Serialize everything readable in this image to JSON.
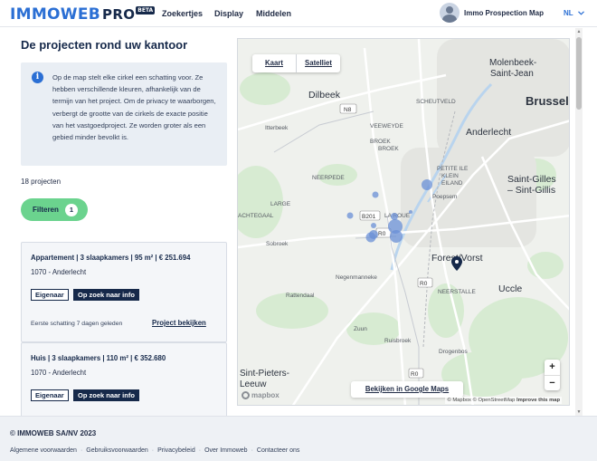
{
  "header": {
    "logo_text": "IMMOWEB",
    "logo_pro": "PRO",
    "logo_badge": "BETA",
    "nav": [
      "Zoekertjes",
      "Display",
      "Middelen"
    ],
    "user_name": "Immo Prospection Map",
    "language": "NL"
  },
  "main": {
    "title": "De projecten rond uw kantoor",
    "info_text": "Op de map stelt elke cirkel een schatting voor. Ze hebben verschillende kleuren, afhankelijk van de termijn van het project. Om de privacy te waarborgen, verbergt de grootte van de cirkels de exacte positie van het vastgoedproject. Ze worden groter als een gebied minder bevolkt is.",
    "project_count": "18 projecten",
    "filter_label": "Filteren",
    "filter_count": "1",
    "projects": [
      {
        "title": "Appartement | 3 slaapkamers | 95 m² | € 251.694",
        "location": "1070 - Anderlecht",
        "tag_owner": "Eigenaar",
        "tag_status": "Op zoek naar info",
        "date": "Eerste schatting 7 dagen geleden",
        "link": "Project bekijken"
      },
      {
        "title": "Huis | 3 slaapkamers | 110 m² | € 352.680",
        "location": "1070 - Anderlecht",
        "tag_owner": "Eigenaar",
        "tag_status": "Op zoek naar info"
      }
    ]
  },
  "map": {
    "view_map": "Kaart",
    "view_satellite": "Satelliet",
    "zoom_in": "+",
    "zoom_out": "−",
    "google_maps_button": "Bekijken in Google Maps",
    "mapbox_logo": "mapbox",
    "attribution": "© Mapbox © OpenStreetMap",
    "improve": "Improve this map",
    "labels": [
      {
        "text": "Molenbeek-",
        "cls": "big"
      },
      {
        "text": "Saint-Jean",
        "cls": "big"
      },
      {
        "text": "Brussels",
        "cls": "city"
      },
      {
        "text": "Dilbeek",
        "cls": "big"
      },
      {
        "text": "Anderlecht",
        "cls": "big"
      },
      {
        "text": "Saint-Gilles",
        "cls": "big"
      },
      {
        "text": "– Sint-Gillis",
        "cls": "big"
      },
      {
        "text": "Forest/Vorst",
        "cls": "big"
      },
      {
        "text": "Uccle",
        "cls": "big"
      },
      {
        "text": "Sint-Pieters-",
        "cls": "big"
      },
      {
        "text": "Leeuw",
        "cls": "big"
      },
      {
        "text": "Itterbeek",
        "cls": "small"
      },
      {
        "text": "SCHEUTVELD",
        "cls": "tiny"
      },
      {
        "text": "VEEWEYDE",
        "cls": "tiny"
      },
      {
        "text": "BROEK",
        "cls": "tiny"
      },
      {
        "text": "BROEK",
        "cls": "tiny"
      },
      {
        "text": "PETITE ILE",
        "cls": "tiny"
      },
      {
        "text": "KLEIN",
        "cls": "tiny"
      },
      {
        "text": "EILAND",
        "cls": "tiny"
      },
      {
        "text": "NEERPEDE",
        "cls": "tiny"
      },
      {
        "text": "LARGE",
        "cls": "tiny"
      },
      {
        "text": "ACHTEGAAL",
        "cls": "tiny"
      },
      {
        "text": "LA ROUE",
        "cls": "tiny"
      },
      {
        "text": "Poepsem",
        "cls": "small"
      },
      {
        "text": "Sobroek",
        "cls": "small"
      },
      {
        "text": "Negenmanneke",
        "cls": "small"
      },
      {
        "text": "Rattendaal",
        "cls": "small"
      },
      {
        "text": "NEERSTALLE",
        "cls": "tiny"
      },
      {
        "text": "Zuun",
        "cls": "small"
      },
      {
        "text": "Ruisbroek",
        "cls": "small"
      },
      {
        "text": "Drogenbos",
        "cls": "small"
      }
    ],
    "shields": [
      "N8",
      "B201",
      "R0",
      "R0",
      "R0"
    ]
  },
  "footer": {
    "copyright": "© IMMOWEB SA/NV 2023",
    "links": [
      "Algemene voorwaarden",
      "Gebruiksvoorwaarden",
      "Privacybeleid",
      "Over Immoweb",
      "Contacteer ons"
    ]
  },
  "colors": {
    "brand_blue": "#2b6fd4",
    "navy": "#16294a",
    "filter_green": "#6bd38e",
    "circle": "#6a8fd6"
  }
}
